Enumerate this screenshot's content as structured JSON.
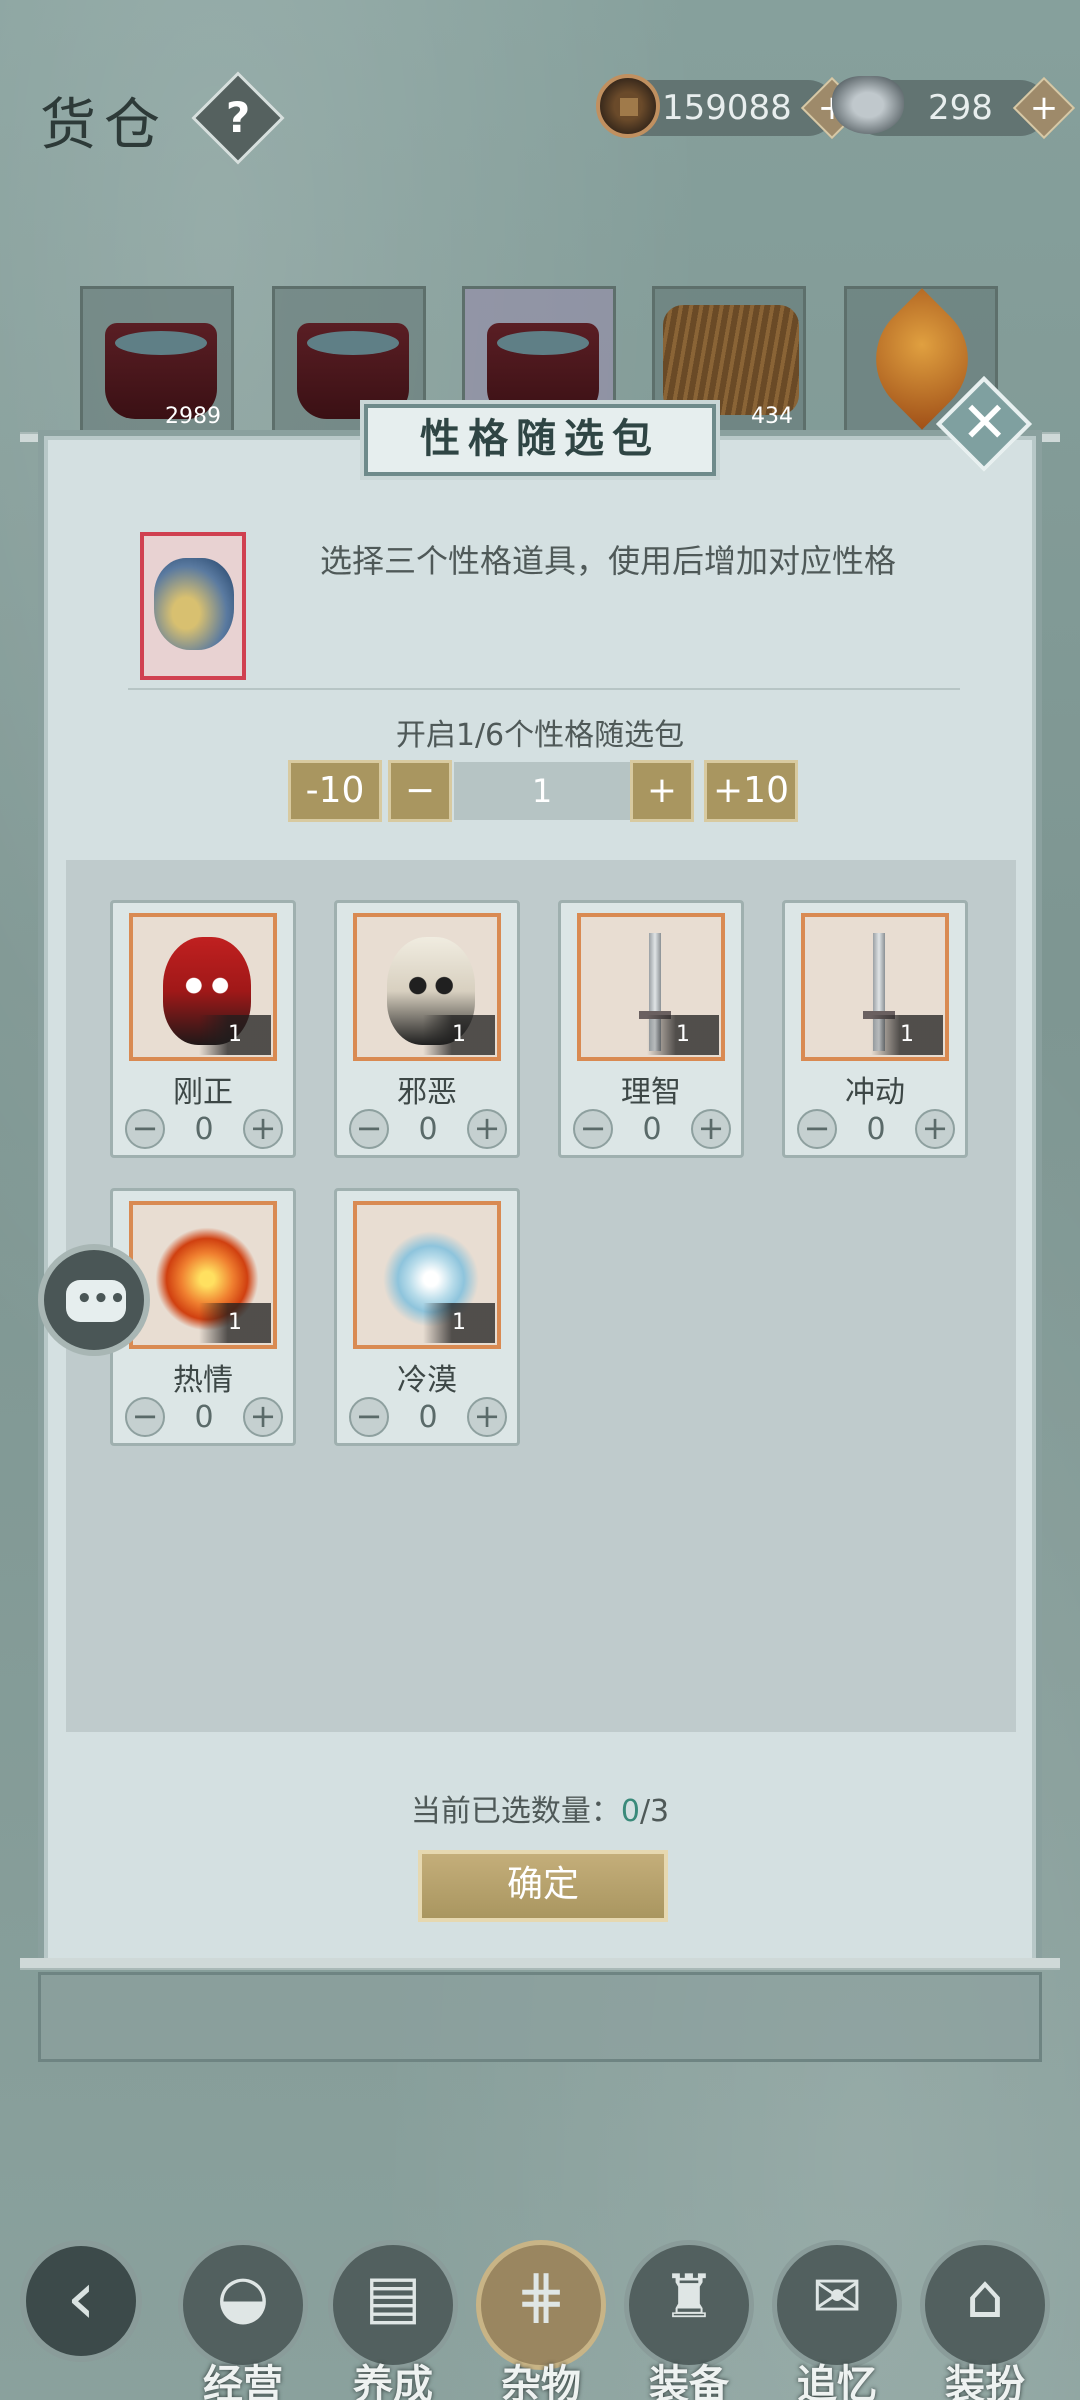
{
  "topbar": {
    "title": "货仓",
    "help_label": "?",
    "currency": [
      {
        "icon": "copper-coin-icon",
        "value": "159088",
        "plus": "+"
      },
      {
        "icon": "silver-ingot-icon",
        "value": "298",
        "plus": "+"
      }
    ]
  },
  "shelf": [
    {
      "icon": "bucket-icon",
      "count": "2989"
    },
    {
      "icon": "bucket-icon",
      "count": ""
    },
    {
      "icon": "bucket-icon",
      "count": ""
    },
    {
      "icon": "straw-bundle-icon",
      "count": "434"
    },
    {
      "icon": "maple-leaf-icon",
      "count": ""
    }
  ],
  "modal": {
    "title": "性格随选包",
    "close_label": "✕",
    "description": "选择三个性格道具，使用后增加对应性格",
    "open_count": "开启1/6个性格随选包",
    "qty": {
      "minus10": "-10",
      "minus": "−",
      "value": "1",
      "plus": "+",
      "plus10": "+10"
    },
    "items": [
      {
        "name": "刚正",
        "count": "1",
        "value": "0",
        "icon": "red-opera-mask-icon"
      },
      {
        "name": "邪恶",
        "count": "1",
        "value": "0",
        "icon": "white-opera-mask-icon"
      },
      {
        "name": "理智",
        "count": "1",
        "value": "0",
        "icon": "sword-icon"
      },
      {
        "name": "冲动",
        "count": "1",
        "value": "0",
        "icon": "sword-icon"
      },
      {
        "name": "热情",
        "count": "1",
        "value": "0",
        "icon": "flame-icon"
      },
      {
        "name": "冷漠",
        "count": "1",
        "value": "0",
        "icon": "snowflake-icon"
      }
    ],
    "stepper_minus": "−",
    "stepper_plus": "+",
    "selected_label": "当前已选数量：",
    "selected_num": "0",
    "selected_total": "/3",
    "confirm_label": "确定"
  },
  "chat_float_label": "•••",
  "bottom_nav": {
    "back_label": "‹",
    "items": [
      {
        "label": "经营",
        "icon": "bowl-icon",
        "active": false
      },
      {
        "label": "养成",
        "icon": "book-icon",
        "active": false
      },
      {
        "label": "杂物",
        "icon": "bundle-icon",
        "active": true
      },
      {
        "label": "装备",
        "icon": "robe-icon",
        "active": false
      },
      {
        "label": "追忆",
        "icon": "letter-icon",
        "active": false
      },
      {
        "label": "装扮",
        "icon": "pavilion-icon",
        "active": false
      }
    ]
  }
}
